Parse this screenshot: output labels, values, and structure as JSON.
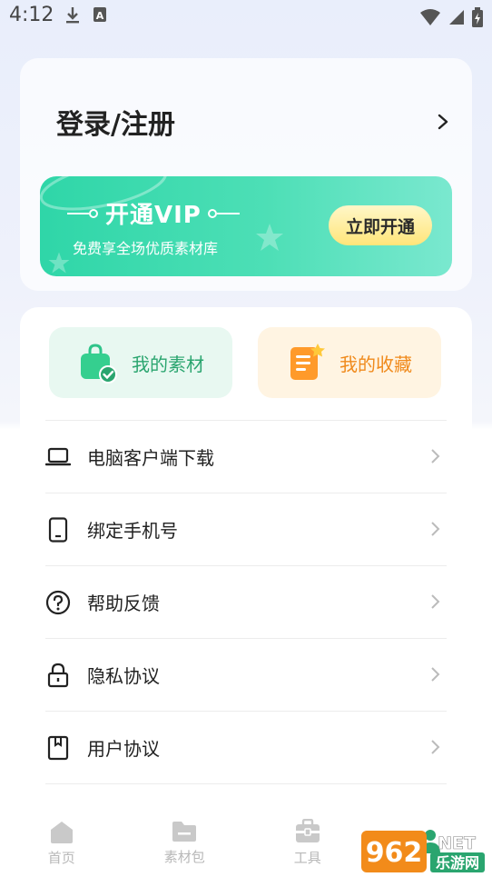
{
  "status_bar": {
    "time": "4:12"
  },
  "header": {
    "login_label": "登录/注册"
  },
  "vip": {
    "title": "开通VIP",
    "subtitle": "免费享全场优质素材库",
    "button": "立即开通"
  },
  "quick": [
    {
      "label": "我的素材",
      "icon": "bag-check-icon"
    },
    {
      "label": "我的收藏",
      "icon": "note-star-icon"
    }
  ],
  "menu": [
    {
      "label": "电脑客户端下载",
      "icon": "laptop-icon"
    },
    {
      "label": "绑定手机号",
      "icon": "phone-icon"
    },
    {
      "label": "帮助反馈",
      "icon": "help-circle-icon"
    },
    {
      "label": "隐私协议",
      "icon": "lock-icon"
    },
    {
      "label": "用户协议",
      "icon": "bookmark-icon"
    }
  ],
  "tabs": [
    {
      "label": "首页",
      "icon": "home-icon"
    },
    {
      "label": "素材包",
      "icon": "folder-icon"
    },
    {
      "label": "工具",
      "icon": "toolbox-icon"
    },
    {
      "label": "",
      "icon": "profile-icon"
    }
  ],
  "watermark": "962 NET 乐游网",
  "colors": {
    "accent": "#2aa56f",
    "vip_start": "#2fd6a8",
    "vip_end": "#7ae8cf",
    "orange": "#f08a1c"
  }
}
